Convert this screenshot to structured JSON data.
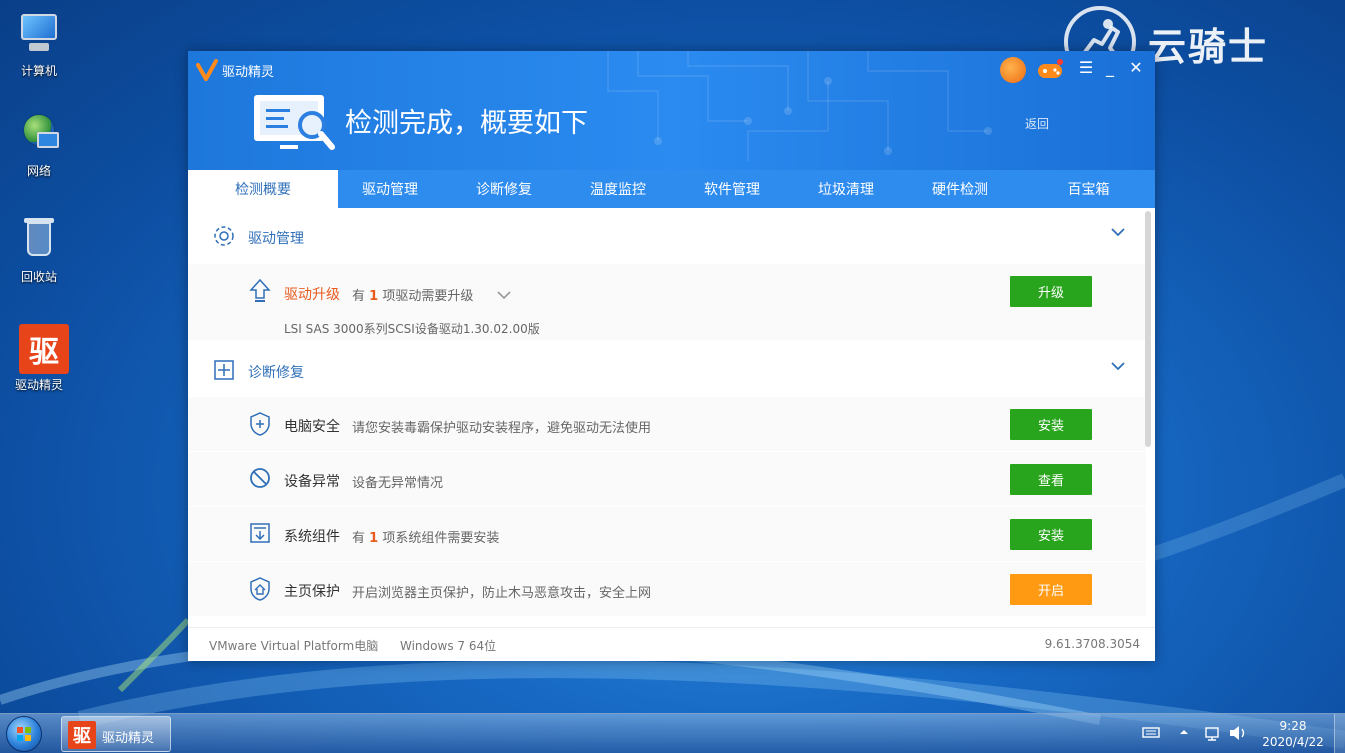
{
  "desktop": {
    "icons": [
      {
        "label": "计算机"
      },
      {
        "label": "网络"
      },
      {
        "label": "回收站"
      },
      {
        "label": "驱动精灵",
        "glyph": "驱"
      }
    ]
  },
  "watermark": {
    "text": "云骑士"
  },
  "window": {
    "app_name": "驱动精灵",
    "banner_title": "检测完成，概要如下",
    "back_label": "返回",
    "controls": {
      "menu": "☰",
      "minimize": "_",
      "close": "✕"
    },
    "tabs": [
      "检测概要",
      "驱动管理",
      "诊断修复",
      "温度监控",
      "软件管理",
      "垃圾清理",
      "硬件检测",
      "百宝箱"
    ],
    "sections": {
      "driver": {
        "title": "驱动管理",
        "upgrade": {
          "name": "驱动升级",
          "desc_prefix": "有",
          "count": "1",
          "desc_suffix": "项驱动需要升级",
          "detail": "LSI SAS 3000系列SCSI设备驱动1.30.02.00版",
          "button": "升级"
        }
      },
      "diagnose": {
        "title": "诊断修复",
        "rows": [
          {
            "name": "电脑安全",
            "desc": "请您安装毒霸保护驱动安装程序，避免驱动无法使用",
            "button": "安装"
          },
          {
            "name": "设备异常",
            "desc": "设备无异常情况",
            "button": "查看"
          },
          {
            "name": "系统组件",
            "desc_prefix": "有",
            "count": "1",
            "desc_suffix": "项系统组件需要安装",
            "button": "安装"
          },
          {
            "name": "主页保护",
            "desc": "开启浏览器主页保护，防止木马恶意攻击，安全上网",
            "button": "开启"
          }
        ]
      }
    },
    "footer": {
      "machine": "VMware Virtual Platform电脑",
      "os": "Windows 7 64位",
      "version": "9.61.3708.3054"
    }
  },
  "taskbar": {
    "item_label": "驱动精灵",
    "item_glyph": "驱",
    "time": "9:28",
    "date": "2020/4/22"
  },
  "colors": {
    "accent_blue": "#2f8cef",
    "section_title": "#2f6fb8",
    "warn_orange": "#e85b1e",
    "button_green": "#29a51d",
    "button_orange": "#ff9a12"
  }
}
